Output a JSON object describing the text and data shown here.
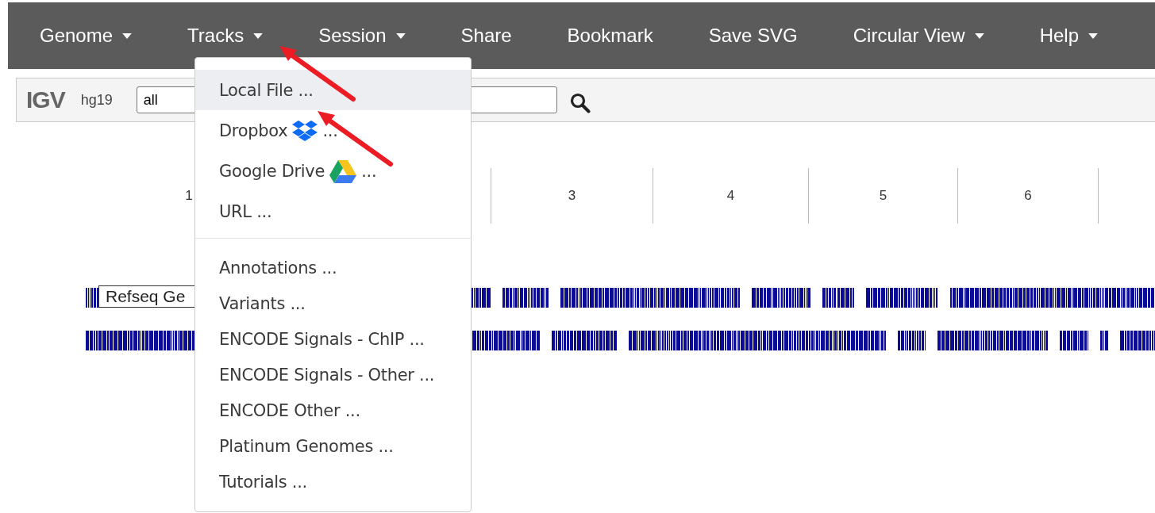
{
  "navbar": {
    "items": [
      {
        "label": "Genome",
        "caret": true
      },
      {
        "label": "Tracks",
        "caret": true
      },
      {
        "label": "Session",
        "caret": true
      },
      {
        "label": "Share",
        "caret": false
      },
      {
        "label": "Bookmark",
        "caret": false
      },
      {
        "label": "Save SVG",
        "caret": false
      },
      {
        "label": "Circular View",
        "caret": true
      },
      {
        "label": "Help",
        "caret": true
      }
    ]
  },
  "toolbar": {
    "logo": "IGV",
    "genome": "hg19",
    "locus": "all"
  },
  "ruler": {
    "labels": [
      "1",
      "3",
      "4",
      "5",
      "6"
    ]
  },
  "tracks": [
    {
      "name": "Refseq Ge"
    }
  ],
  "dropdown": {
    "groups": [
      [
        {
          "kind": "plain",
          "label": "Local File ...",
          "selected": true
        },
        {
          "kind": "dropbox",
          "label": "Dropbox",
          "suffix": "...",
          "selected": false
        },
        {
          "kind": "drive",
          "label": "Google Drive",
          "suffix": "...",
          "selected": false
        },
        {
          "kind": "plain",
          "label": "URL ...",
          "selected": false
        }
      ],
      [
        {
          "kind": "plain",
          "label": "Annotations ...",
          "selected": false
        },
        {
          "kind": "plain",
          "label": "Variants ...",
          "selected": false
        },
        {
          "kind": "plain",
          "label": "ENCODE Signals - ChIP ...",
          "selected": false
        },
        {
          "kind": "plain",
          "label": "ENCODE Signals - Other ...",
          "selected": false
        },
        {
          "kind": "plain",
          "label": "ENCODE Other ...",
          "selected": false
        },
        {
          "kind": "plain",
          "label": "Platinum Genomes ...",
          "selected": false
        },
        {
          "kind": "plain",
          "label": "Tutorials ...",
          "selected": false
        }
      ]
    ]
  }
}
